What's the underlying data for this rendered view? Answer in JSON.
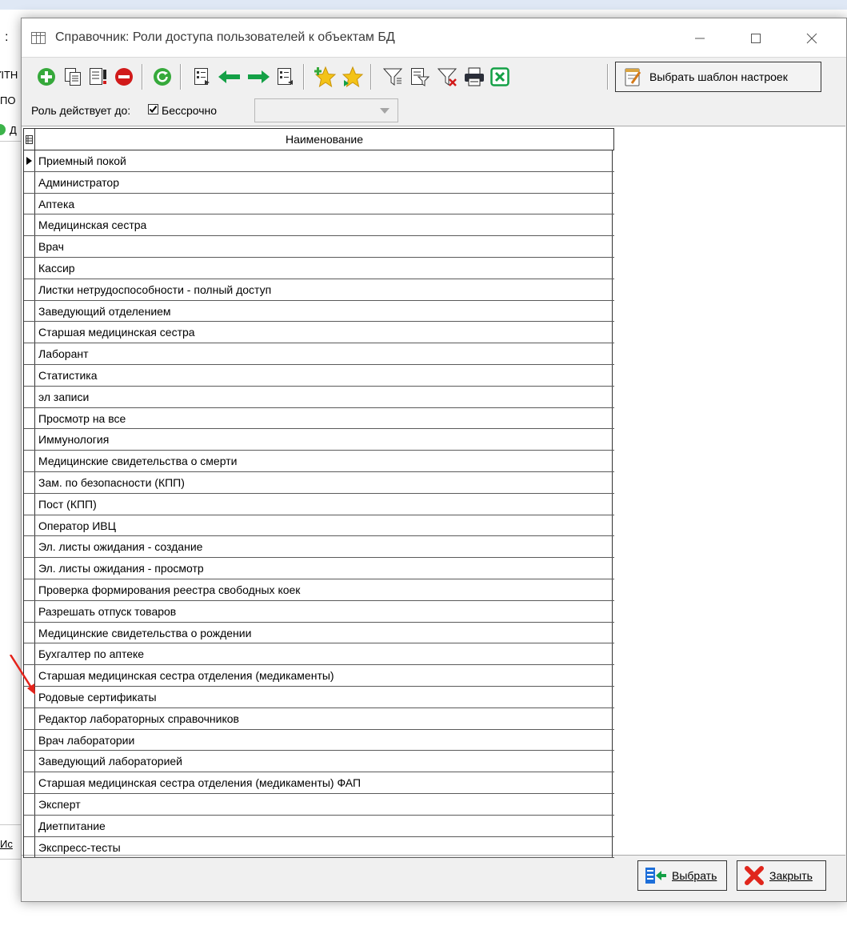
{
  "background_app": {
    "fragments": [
      ":",
      "ΊΤΗ",
      "ПО",
      "Д",
      "Ис"
    ]
  },
  "dialog": {
    "title": "Справочник: Роли доступа пользователей к объектам БД",
    "toolbar": {
      "buttons": [
        "add-icon",
        "copy-icon",
        "edit-icon",
        "delete-icon",
        "refresh-icon",
        "expand-icon",
        "arrow-left-icon",
        "arrow-right-icon",
        "collapse-icon",
        "favorite-add-icon",
        "favorite-icon",
        "filter-icon",
        "filter-edit-icon",
        "filter-clear-icon",
        "print-icon",
        "excel-icon"
      ],
      "template_button_label": "Выбрать шаблон настроек"
    },
    "options": {
      "role_valid_label": "Роль действует до:",
      "unlimited_label": "Бессрочно",
      "unlimited_checked": true,
      "date_value": ""
    },
    "grid": {
      "column_header": "Наименование",
      "rows": [
        "Приемный покой",
        "Администратор",
        "Аптека",
        "Медицинская сестра",
        "Врач",
        "Кассир",
        "Листки нетрудоспособности - полный доступ",
        "Заведующий отделением",
        "Старшая медицинская сестра",
        "Лаборант",
        "Статистика",
        "эл записи",
        "Просмотр на все",
        "Иммунология",
        "Медицинские свидетельства о смерти",
        "Зам. по безопасности (КПП)",
        "Пост (КПП)",
        "Оператор ИВЦ",
        "Эл. листы ожидания - создание",
        "Эл. листы ожидания - просмотр",
        "Проверка формирования реестра свободных коек",
        "Разрешать отпуск товаров",
        "Медицинские свидетельства о рождении",
        "Бухгалтер по аптеке",
        "Старшая медицинская сестра отделения (медикаменты)",
        "Родовые сертификаты",
        "Редактор лабораторных справочников",
        "Врач лаборатории",
        "Заведующий лабораторией",
        "Старшая медицинская сестра отделения (медикаменты) ФАП",
        "Эксперт",
        "Диетпитание",
        "Экспресс-тесты"
      ],
      "current_row": 0
    },
    "bottom": {
      "select_label": "Выбрать",
      "close_label": "Закрыть"
    }
  },
  "colors": {
    "annotation_arrow": "#e5231b",
    "accent_green": "#3cb34a",
    "delete_red": "#d11a1a"
  }
}
